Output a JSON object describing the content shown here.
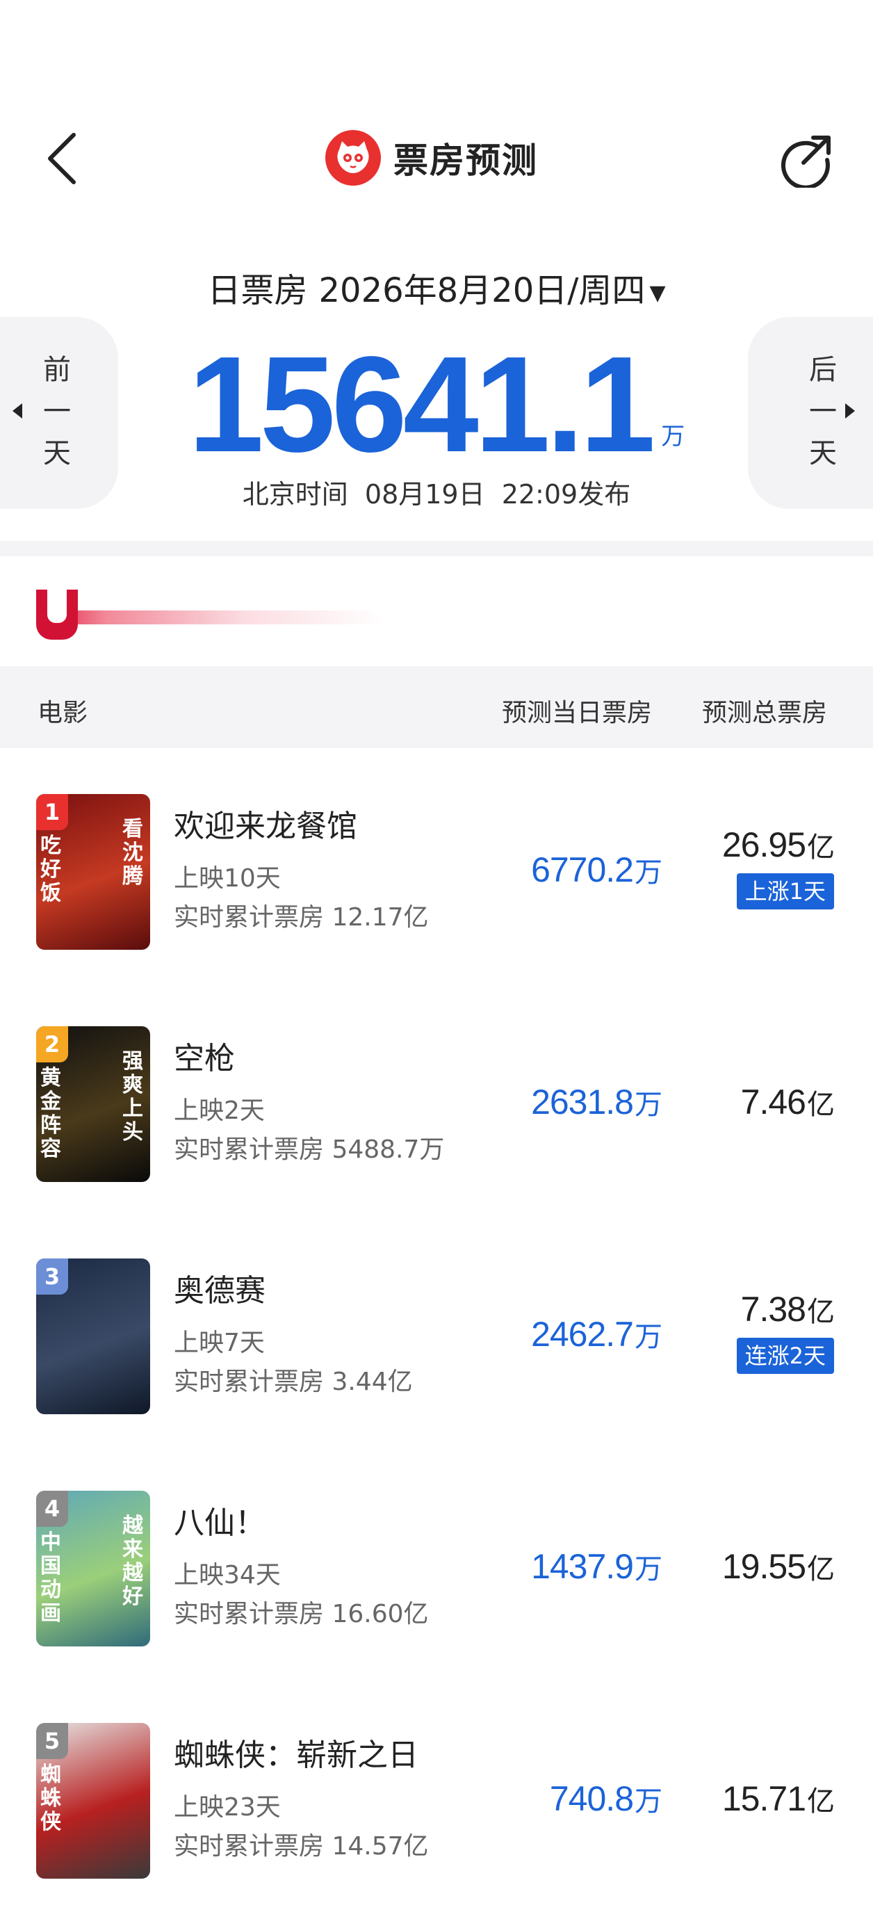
{
  "header": {
    "title": "票房预测"
  },
  "date_bar": {
    "label": "日票房",
    "date": "2026年8月20日/周四",
    "caret": "▼"
  },
  "prev_day": {
    "c1": "前",
    "c2": "一",
    "c3": "天"
  },
  "next_day": {
    "c1": "后",
    "c2": "一",
    "c3": "天"
  },
  "summary": {
    "total": "15641.1",
    "unit": "万",
    "publish_prefix": "北京时间",
    "publish_date": "08月19日",
    "publish_time": "22:09发布"
  },
  "table_header": {
    "movie": "电影",
    "day": "预测当日票房",
    "total": "预测总票房"
  },
  "movies": [
    {
      "rank": "1",
      "name": "欢迎来龙餐馆",
      "days": "上映10天",
      "cumulative": "实时累计票房 12.17亿",
      "day_value": "6770.2",
      "day_unit": "万",
      "total_value": "26.95",
      "total_unit": "亿",
      "badge": "上涨1天",
      "poster_left": "吃好饭",
      "poster_right": "看沈腾",
      "rank_color": "#e8302f",
      "poster_colors": [
        "#7a1010",
        "#c53a22",
        "#5a0c0c"
      ]
    },
    {
      "rank": "2",
      "name": "空枪",
      "days": "上映2天",
      "cumulative": "实时累计票房 5488.7万",
      "day_value": "2631.8",
      "day_unit": "万",
      "total_value": "7.46",
      "total_unit": "亿",
      "badge": "",
      "poster_left": "黄金阵容",
      "poster_right": "强爽上头",
      "rank_color": "#f5a623",
      "poster_colors": [
        "#111111",
        "#4a3a1a",
        "#0a0a0a"
      ]
    },
    {
      "rank": "3",
      "name": "奥德赛",
      "days": "上映7天",
      "cumulative": "实时累计票房 3.44亿",
      "day_value": "2462.7",
      "day_unit": "万",
      "total_value": "7.38",
      "total_unit": "亿",
      "badge": "连涨2天",
      "poster_left": "",
      "poster_right": "",
      "rank_color": "#6c8ed6",
      "poster_colors": [
        "#1c2a44",
        "#3a4a66",
        "#0f1828"
      ]
    },
    {
      "rank": "4",
      "name": "八仙！",
      "days": "上映34天",
      "cumulative": "实时累计票房 16.60亿",
      "day_value": "1437.9",
      "day_unit": "万",
      "total_value": "19.55",
      "total_unit": "亿",
      "badge": "",
      "poster_left": "中国动画",
      "poster_right": "越来越好",
      "rank_color": "#8a8a8a",
      "poster_colors": [
        "#5fa8b8",
        "#9bcf7a",
        "#2f6a7a"
      ]
    },
    {
      "rank": "5",
      "name": "蜘蛛侠：崭新之日",
      "days": "上映23天",
      "cumulative": "实时累计票房 14.57亿",
      "day_value": "740.8",
      "day_unit": "万",
      "total_value": "15.71",
      "total_unit": "亿",
      "badge": "",
      "poster_left": "蜘蛛侠",
      "poster_right": "",
      "rank_color": "#8a8a8a",
      "poster_colors": [
        "#e6e6e6",
        "#b82020",
        "#3a3a3a"
      ]
    }
  ]
}
